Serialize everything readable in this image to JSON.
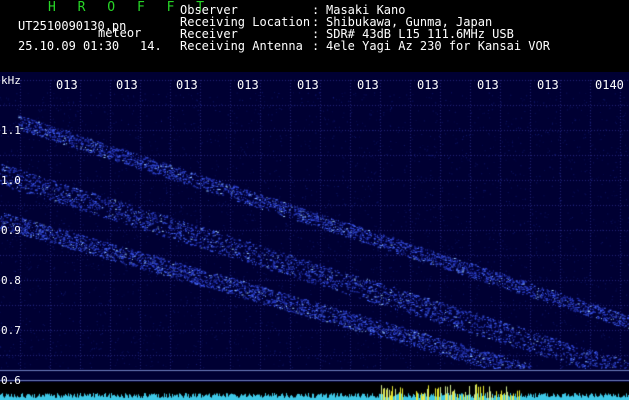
{
  "app": {
    "title": "H R O F F T"
  },
  "file": {
    "name": "UT2510090130.pn",
    "type": "meteor",
    "datetime": "25.10.09 01:30",
    "count": "14."
  },
  "info": [
    {
      "label": "Observer",
      "value": "Masaki Kano"
    },
    {
      "label": "Receiving Location",
      "value": "Shibukawa, Gunma, Japan"
    },
    {
      "label": "Receiver",
      "value": "SDR# 43dB L15 111.6MHz USB"
    },
    {
      "label": "Receiving Antenna",
      "value": "4ele Yagi Az 230 for Kansai VOR"
    }
  ],
  "spectrogram": {
    "unit": "kHz",
    "x_ticks": [
      "013",
      "013",
      "013",
      "013",
      "013",
      "013",
      "013",
      "013",
      "013",
      "0140"
    ],
    "y_ticks": [
      "1.1",
      "1.0",
      "0.9",
      "0.8",
      "0.7",
      "0.6"
    ],
    "colors": {
      "background": "#000033",
      "signal": "#4466ff",
      "grid": "#24247a",
      "baseline": "#3ec8e6",
      "peak": "#e8e830"
    }
  }
}
